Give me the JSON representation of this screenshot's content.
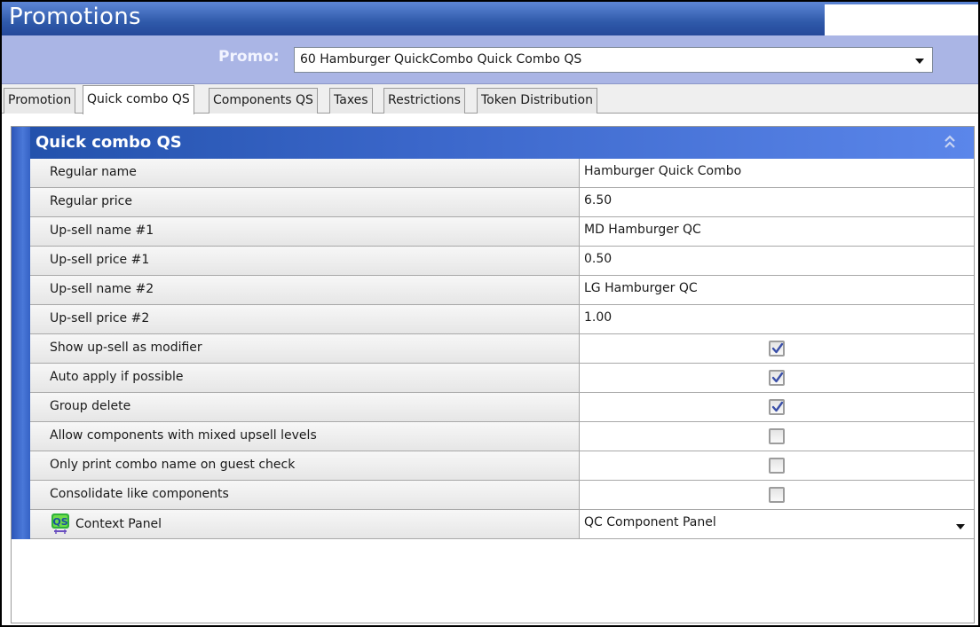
{
  "window": {
    "title": "Promotions"
  },
  "promo": {
    "label": "Promo:",
    "selected": "60 Hamburger QuickCombo Quick Combo QS"
  },
  "tabs": [
    {
      "label": "Promotion",
      "active": false
    },
    {
      "label": "Quick combo QS",
      "active": true
    },
    {
      "label": "Components QS",
      "active": false
    },
    {
      "label": "Taxes",
      "active": false
    },
    {
      "label": "Restrictions",
      "active": false
    },
    {
      "label": "Token Distribution",
      "active": false
    }
  ],
  "section": {
    "title": "Quick combo QS",
    "collapse_icon": "double-chevron-up-icon",
    "fields": [
      {
        "label": "Regular name",
        "type": "text",
        "value": "Hamburger Quick Combo"
      },
      {
        "label": "Regular price",
        "type": "text",
        "value": "6.50"
      },
      {
        "label": "Up-sell name #1",
        "type": "text",
        "value": "MD Hamburger QC"
      },
      {
        "label": "Up-sell price #1",
        "type": "text",
        "value": "0.50"
      },
      {
        "label": "Up-sell name #2",
        "type": "text",
        "value": "LG Hamburger QC"
      },
      {
        "label": "Up-sell price #2",
        "type": "text",
        "value": "1.00"
      },
      {
        "label": "Show up-sell as modifier",
        "type": "checkbox",
        "checked": true
      },
      {
        "label": "Auto apply if possible",
        "type": "checkbox",
        "checked": true
      },
      {
        "label": "Group delete",
        "type": "checkbox",
        "checked": true
      },
      {
        "label": "Allow components with mixed upsell levels",
        "type": "checkbox",
        "checked": false
      },
      {
        "label": "Only print combo name on guest check",
        "type": "checkbox",
        "checked": false
      },
      {
        "label": "Consolidate like components",
        "type": "checkbox",
        "checked": false
      },
      {
        "label": "Context Panel",
        "type": "select",
        "value": "QC Component Panel",
        "icon": "qs-icon"
      }
    ]
  },
  "colors": {
    "title_bar": "#2f5aaa",
    "promo_bar": "#aab5e5",
    "section_header": "#3a66c9",
    "checkmark": "#3a4fa8"
  }
}
